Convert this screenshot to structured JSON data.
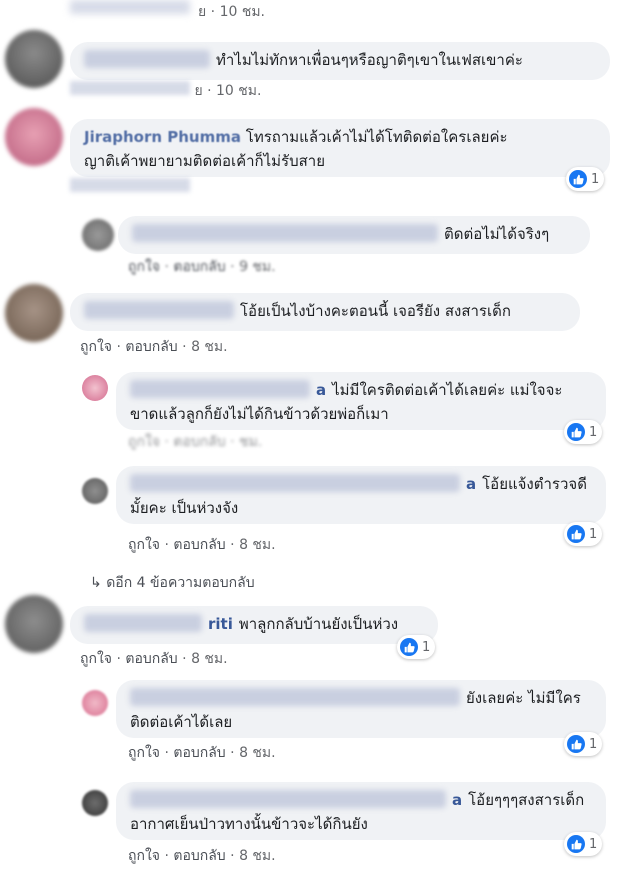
{
  "actions": {
    "like": "ถูกใจ",
    "reply": "ตอบกลับ",
    "dot": "·"
  },
  "top_meta": {
    "time": "10 ชม."
  },
  "comments": [
    {
      "text": "ทำไมไม่ทักหาเพื่อนๆหรือญาติๆเขาในเฟสเขาค่ะ",
      "time": "10 ชม."
    },
    {
      "name": "Jiraphorn Phumma",
      "line1": "โทรถามแล้วเค้าไม่ได้โทติดต่อใครเลยค่ะ",
      "line2": "ญาติเค้าพยายามติดต่อเค้าก็ไม่รับสาย",
      "reactions": "1"
    },
    {
      "text": "ติดต่อไม่ได้จริงๆ",
      "time": "9 ชม."
    },
    {
      "text": "โอ้ยเป็นไงบ้างคะตอนนี้ เจอรียัง สงสารเด็ก",
      "time": "8 ชม."
    },
    {
      "name_suffix": "a",
      "line1": "ไม่มีใครติดต่อเค้าได้เลยค่ะ แม่ใจจะ",
      "line2": "ขาดแล้วลูกก็ยังไม่ได้กินข้าวด้วยพ่อก็เมา",
      "reactions": "1"
    },
    {
      "name_suffix": "a",
      "line1": "โอ้ยแจ้งตำรวจดี",
      "line2": "มั้ยคะ เป็นห่วงจัง",
      "reactions": "1",
      "time": "8 ชม."
    },
    {
      "name_suffix": "riti",
      "text": "พาลูกกลับบ้านยังเป็นห่วง",
      "reactions": "1",
      "time": "8 ชม."
    },
    {
      "line1": "ยังเลยค่ะ ไม่มีใคร",
      "line2": "ติดต่อเค้าได้เลย",
      "reactions": "1",
      "time": "8 ชม."
    },
    {
      "name_suffix": "a",
      "line1": "โอ้ยๆๆๆสงสารเด็ก",
      "line2": "อากาศเย็นป่าวทางนั้นข้าวจะได้กินยัง",
      "reactions": "1",
      "time": "8 ชม."
    }
  ],
  "more_replies": "ดอีก 4 ข้อความตอบกลับ",
  "colors": {
    "like_blue": "#1877f2",
    "name_blue": "#385898",
    "bubble": "#f0f2f5"
  }
}
